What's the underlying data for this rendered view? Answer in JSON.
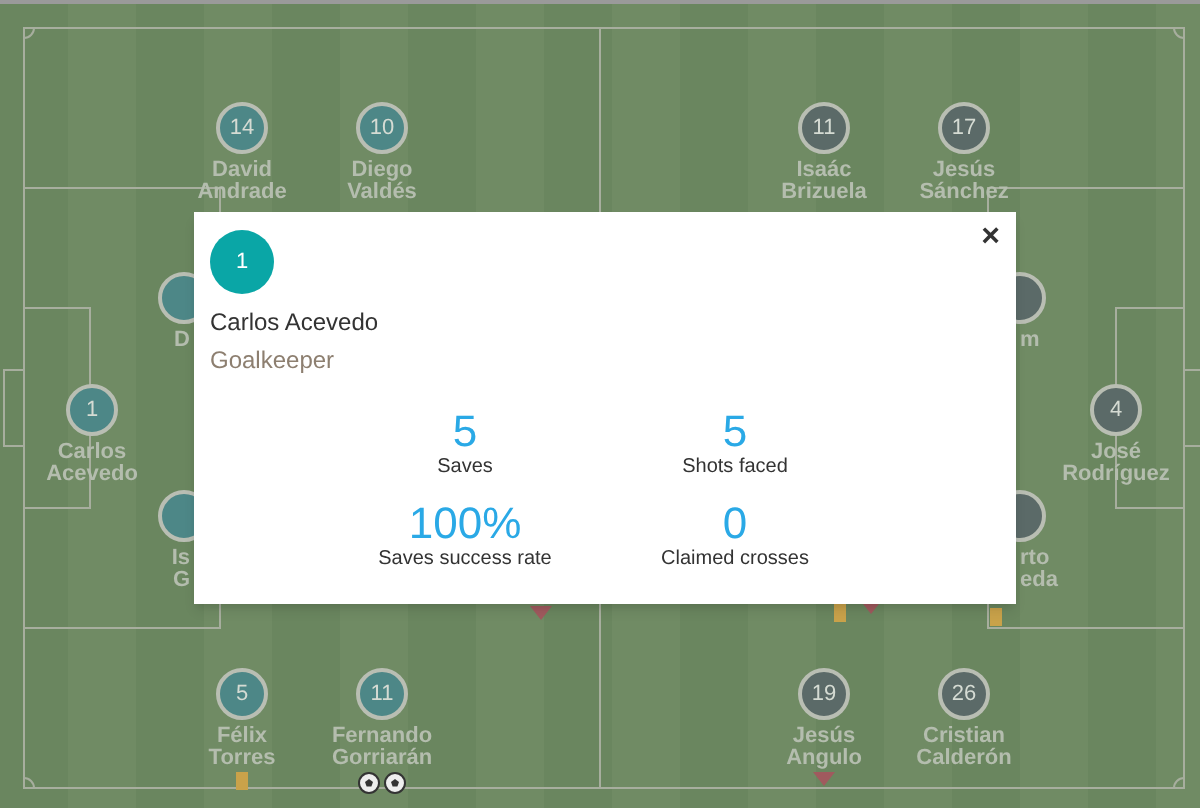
{
  "teams": [
    {
      "color": "#4d8787",
      "players": [
        {
          "number": "14",
          "name": "David Andrade"
        },
        {
          "number": "10",
          "name": "Diego Valdés"
        },
        {
          "number": "1",
          "name": "Carlos Acevedo"
        },
        {
          "name": "D"
        },
        {
          "name": "Is G"
        },
        {
          "number": "5",
          "name": "Félix Torres",
          "events": [
            {
              "kind": "card"
            }
          ]
        },
        {
          "number": "11",
          "name": "Fernando Gorriarán",
          "events": [
            {
              "kind": "goal"
            },
            {
              "kind": "goal"
            }
          ]
        }
      ]
    },
    {
      "color": "#5b6a68",
      "players": [
        {
          "number": "11",
          "name": "Isaác Brizuela"
        },
        {
          "number": "17",
          "name": "Jesús Sánchez"
        },
        {
          "number": "4",
          "name": "José Rodríguez"
        },
        {
          "name": "m"
        },
        {
          "name": "rto eda"
        },
        {
          "number": "19",
          "name": "Jesús Angulo",
          "events": [
            {
              "kind": "sub_off"
            }
          ]
        },
        {
          "number": "26",
          "name": "Cristian Calderón"
        }
      ]
    }
  ],
  "loose_events": [
    {
      "kind": "sub_off"
    },
    {
      "kind": "card"
    },
    {
      "kind": "sub_off"
    },
    {
      "kind": "card"
    }
  ],
  "popup": {
    "number": "1",
    "name": "Carlos Acevedo",
    "position": "Goalkeeper",
    "close": "×",
    "stats": [
      {
        "value": "5",
        "label": "Saves"
      },
      {
        "value": "5",
        "label": "Shots faced"
      },
      {
        "value": "100%",
        "label": "Saves success rate"
      },
      {
        "value": "0",
        "label": "Claimed crosses"
      }
    ]
  }
}
